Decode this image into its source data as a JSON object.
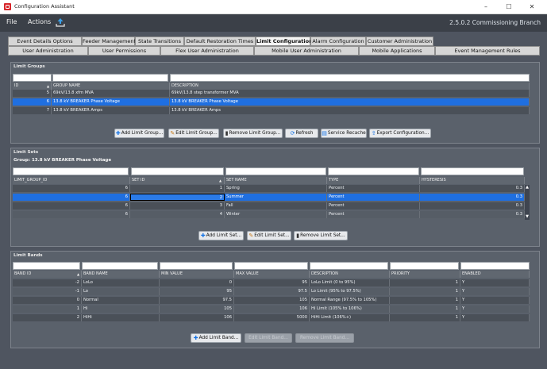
{
  "window": {
    "title": "Configuration Assistant",
    "minimize": "–",
    "maximize": "☐",
    "close": "✕"
  },
  "menu": {
    "file": "File",
    "actions": "Actions",
    "version": "2.5.0.2 Commissioning Branch"
  },
  "tabs_row1": [
    "Event Details Options",
    "Feeder Management",
    "State Transitions",
    "Default Restoration Times",
    "Limit Configuration",
    "Alarm Configuration",
    "Customer Administration"
  ],
  "tabs_row2": [
    "User Administration",
    "User Permissions",
    "Flex User Administration",
    "Mobile User Administration",
    "Mobile Applications",
    "Event Management Rules"
  ],
  "limit_groups": {
    "title": "Limit Groups",
    "columns": [
      "ID",
      "GROUP NAME",
      "DESCRIPTION"
    ],
    "rows": [
      [
        "5",
        "69kV/13.8 xfm MVA",
        "69kV/13.8 step transformer MVA"
      ],
      [
        "6",
        "13.8 kV BREAKER Phase Voltage",
        "13.8 kV BREAKER Phase Voltage"
      ],
      [
        "7",
        "13.8 kV BREAKER Amps",
        "13.8 kV BREAKER Amps"
      ]
    ],
    "buttons": {
      "add": "Add Limit Group...",
      "edit": "Edit Limit Group...",
      "remove": "Remove Limit Group...",
      "refresh": "Refresh",
      "recache": "Service Recache",
      "export": "Export Configuration..."
    }
  },
  "limit_sets": {
    "title": "Limit Sets",
    "group_label": "Group: 13.8 kV BREAKER Phase Voltage",
    "columns": [
      "LIMIT_GROUP_ID",
      "SET ID",
      "SET NAME",
      "TYPE",
      "HYSTERESIS"
    ],
    "rows": [
      [
        "6",
        "1",
        "Spring",
        "Percent",
        "0.3"
      ],
      [
        "6",
        "2",
        "Summer",
        "Percent",
        "0.3"
      ],
      [
        "6",
        "3",
        "Fall",
        "Percent",
        "0.3"
      ],
      [
        "6",
        "4",
        "Winter",
        "Percent",
        "0.3"
      ]
    ],
    "buttons": {
      "add": "Add Limit Set...",
      "edit": "Edit Limit Set...",
      "remove": "Remove Limit Set..."
    }
  },
  "limit_bands": {
    "title": "Limit Bands",
    "columns": [
      "BAND ID",
      "BAND NAME",
      "MIN VALUE",
      "MAX VALUE",
      "DESCRIPTION",
      "PRIORITY",
      "ENABLED"
    ],
    "rows": [
      [
        "-2",
        "LoLo",
        "0",
        "95",
        "LoLo Limit (0 to 95%)",
        "1",
        "Y"
      ],
      [
        "-1",
        "Lo",
        "95",
        "97.5",
        "Lo Limit (95% to 97.5%)",
        "1",
        "Y"
      ],
      [
        "0",
        "Normal",
        "97.5",
        "105",
        "Normal Range (97.5% to 105%)",
        "1",
        "Y"
      ],
      [
        "1",
        "Hi",
        "105",
        "106",
        "Hi Limit (105% to 106%)",
        "1",
        "Y"
      ],
      [
        "2",
        "HiHi",
        "106",
        "5000",
        "HiHi Limit (106%+)",
        "1",
        "Y"
      ]
    ],
    "buttons": {
      "add": "Add Limit Band...",
      "edit": "Edit Limit Band...",
      "remove": "Remove Limit Band..."
    }
  }
}
